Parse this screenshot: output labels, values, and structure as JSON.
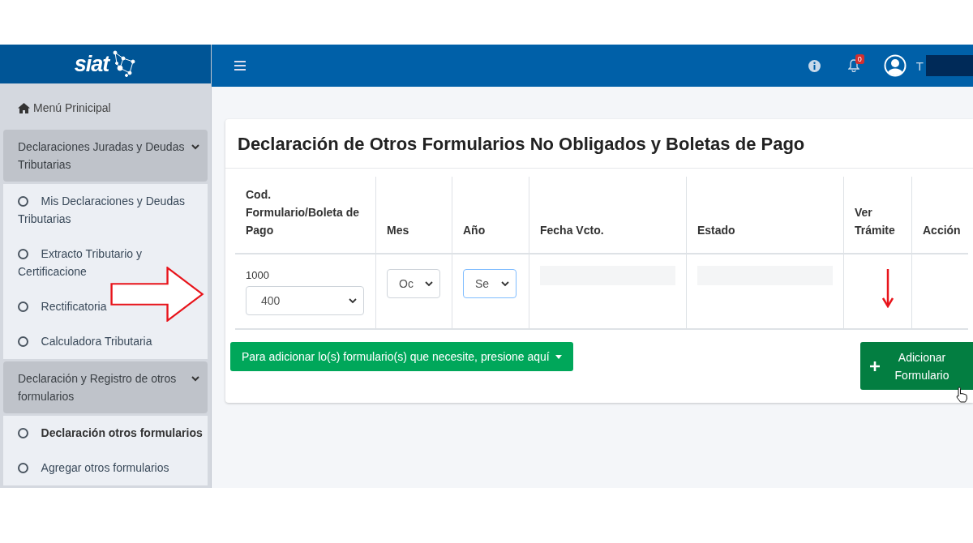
{
  "brand": {
    "logo": "siat"
  },
  "header": {
    "notifications": "0",
    "user": "T"
  },
  "sidebar": {
    "home": "Menú Prinicipal",
    "groups": [
      {
        "label": "Declaraciones Juradas y Deudas Tributarias",
        "expanded": true,
        "items": [
          {
            "label": "Mis Declaraciones y Deudas Tributarias",
            "selected": false
          },
          {
            "label": "Extracto Tributario y Certificacione",
            "selected": false
          },
          {
            "label": "Rectificatoria",
            "selected": false
          },
          {
            "label": "Calculadora Tributaria",
            "selected": false
          }
        ]
      },
      {
        "label": "Declaración y Registro de otros formularios",
        "expanded": true,
        "items": [
          {
            "label": "Declaración otros formularios",
            "selected": true
          },
          {
            "label": "Agregar otros formularios",
            "selected": false
          }
        ]
      }
    ]
  },
  "card": {
    "title": "Declaración de Otros Formularios No Obligados y Boletas de Pago",
    "table": {
      "columns": [
        "Cod. Formulario/Boleta de Pago",
        "Mes",
        "Año",
        "Fecha Vcto.",
        "Estado",
        "Ver Trámite",
        "Acción"
      ],
      "row": {
        "code": "1000",
        "form": {
          "value": "400",
          "focused": false
        },
        "month": {
          "value": "Oc",
          "focused": false
        },
        "year": {
          "value": "Se",
          "focused": true
        }
      }
    },
    "dropdown_button": "Para adicionar lo(s) formulario(s) que necesite, presione aquí",
    "add_button": "Adicionar Formulario"
  }
}
